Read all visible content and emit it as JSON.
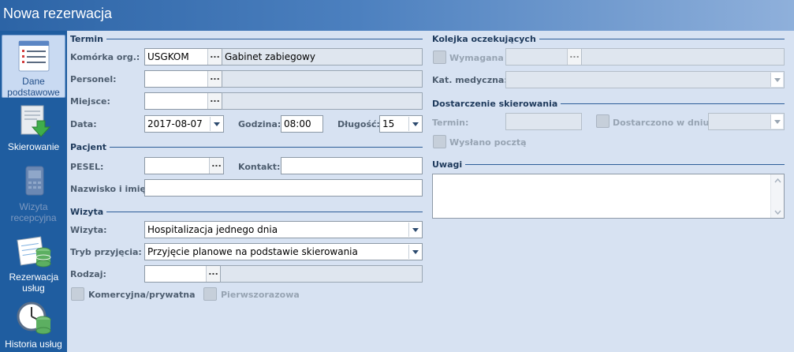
{
  "window": {
    "title": "Nowa rezerwacja"
  },
  "sidebar": {
    "items": [
      {
        "label": "Dane podstawowe",
        "state": "active",
        "icon": "list-document-icon"
      },
      {
        "label": "Skierowanie",
        "state": "normal",
        "icon": "document-arrow-icon"
      },
      {
        "label": "Wizyta recepcyjna",
        "state": "disabled",
        "icon": "phone-icon"
      },
      {
        "label": "Rezerwacja usług",
        "state": "normal",
        "icon": "calendar-database-icon"
      },
      {
        "label": "Historia usług",
        "state": "normal",
        "icon": "clock-database-icon"
      }
    ]
  },
  "termin": {
    "section": "Termin",
    "komorka_label": "Komórka org.:",
    "komorka_code": "USGKOM",
    "komorka_name": "Gabinet zabiegowy",
    "personel_label": "Personel:",
    "personel_code": "",
    "personel_name": "",
    "miejsce_label": "Miejsce:",
    "miejsce_code": "",
    "miejsce_name": "",
    "data_label": "Data:",
    "data_value": "2017-08-07",
    "godzina_label": "Godzina:",
    "godzina_value": "08:00",
    "dlugosc_label": "Długość:",
    "dlugosc_value": "15"
  },
  "pacjent": {
    "section": "Pacjent",
    "pesel_label": "PESEL:",
    "pesel_value": "",
    "kontakt_label": "Kontakt:",
    "kontakt_value": "",
    "nazwisko_label": "Nazwisko i imię:",
    "nazwisko_value": ""
  },
  "wizyta": {
    "section": "Wizyta",
    "wizyta_label": "Wizyta:",
    "wizyta_value": "Hospitalizacja jednego dnia",
    "tryb_label": "Tryb przyjęcia:",
    "tryb_value": "Przyjęcie planowe na podstawie skierowania",
    "rodzaj_label": "Rodzaj:",
    "rodzaj_value": "",
    "komercyjna_label": "Komercyjna/prywatna",
    "pierwszorazowa_label": "Pierwszorazowa"
  },
  "kolejka": {
    "section": "Kolejka oczekujących",
    "wymagana_label": "Wymagana",
    "kat_label": "Kat. medyczna:",
    "kat_value": ""
  },
  "dostarczenie": {
    "section": "Dostarczenie skierowania",
    "termin_label": "Termin:",
    "termin_value": "",
    "dostarczono_label": "Dostarczono w dniu:",
    "dostarczono_value": "",
    "wyslano_label": "Wysłano pocztą"
  },
  "uwagi": {
    "section": "Uwagi",
    "value": ""
  },
  "colors": {
    "titlebar": "#2c64a6",
    "sidebar": "#1f5da0",
    "panel": "#d7e2f2",
    "section_line": "#2c5d98"
  }
}
